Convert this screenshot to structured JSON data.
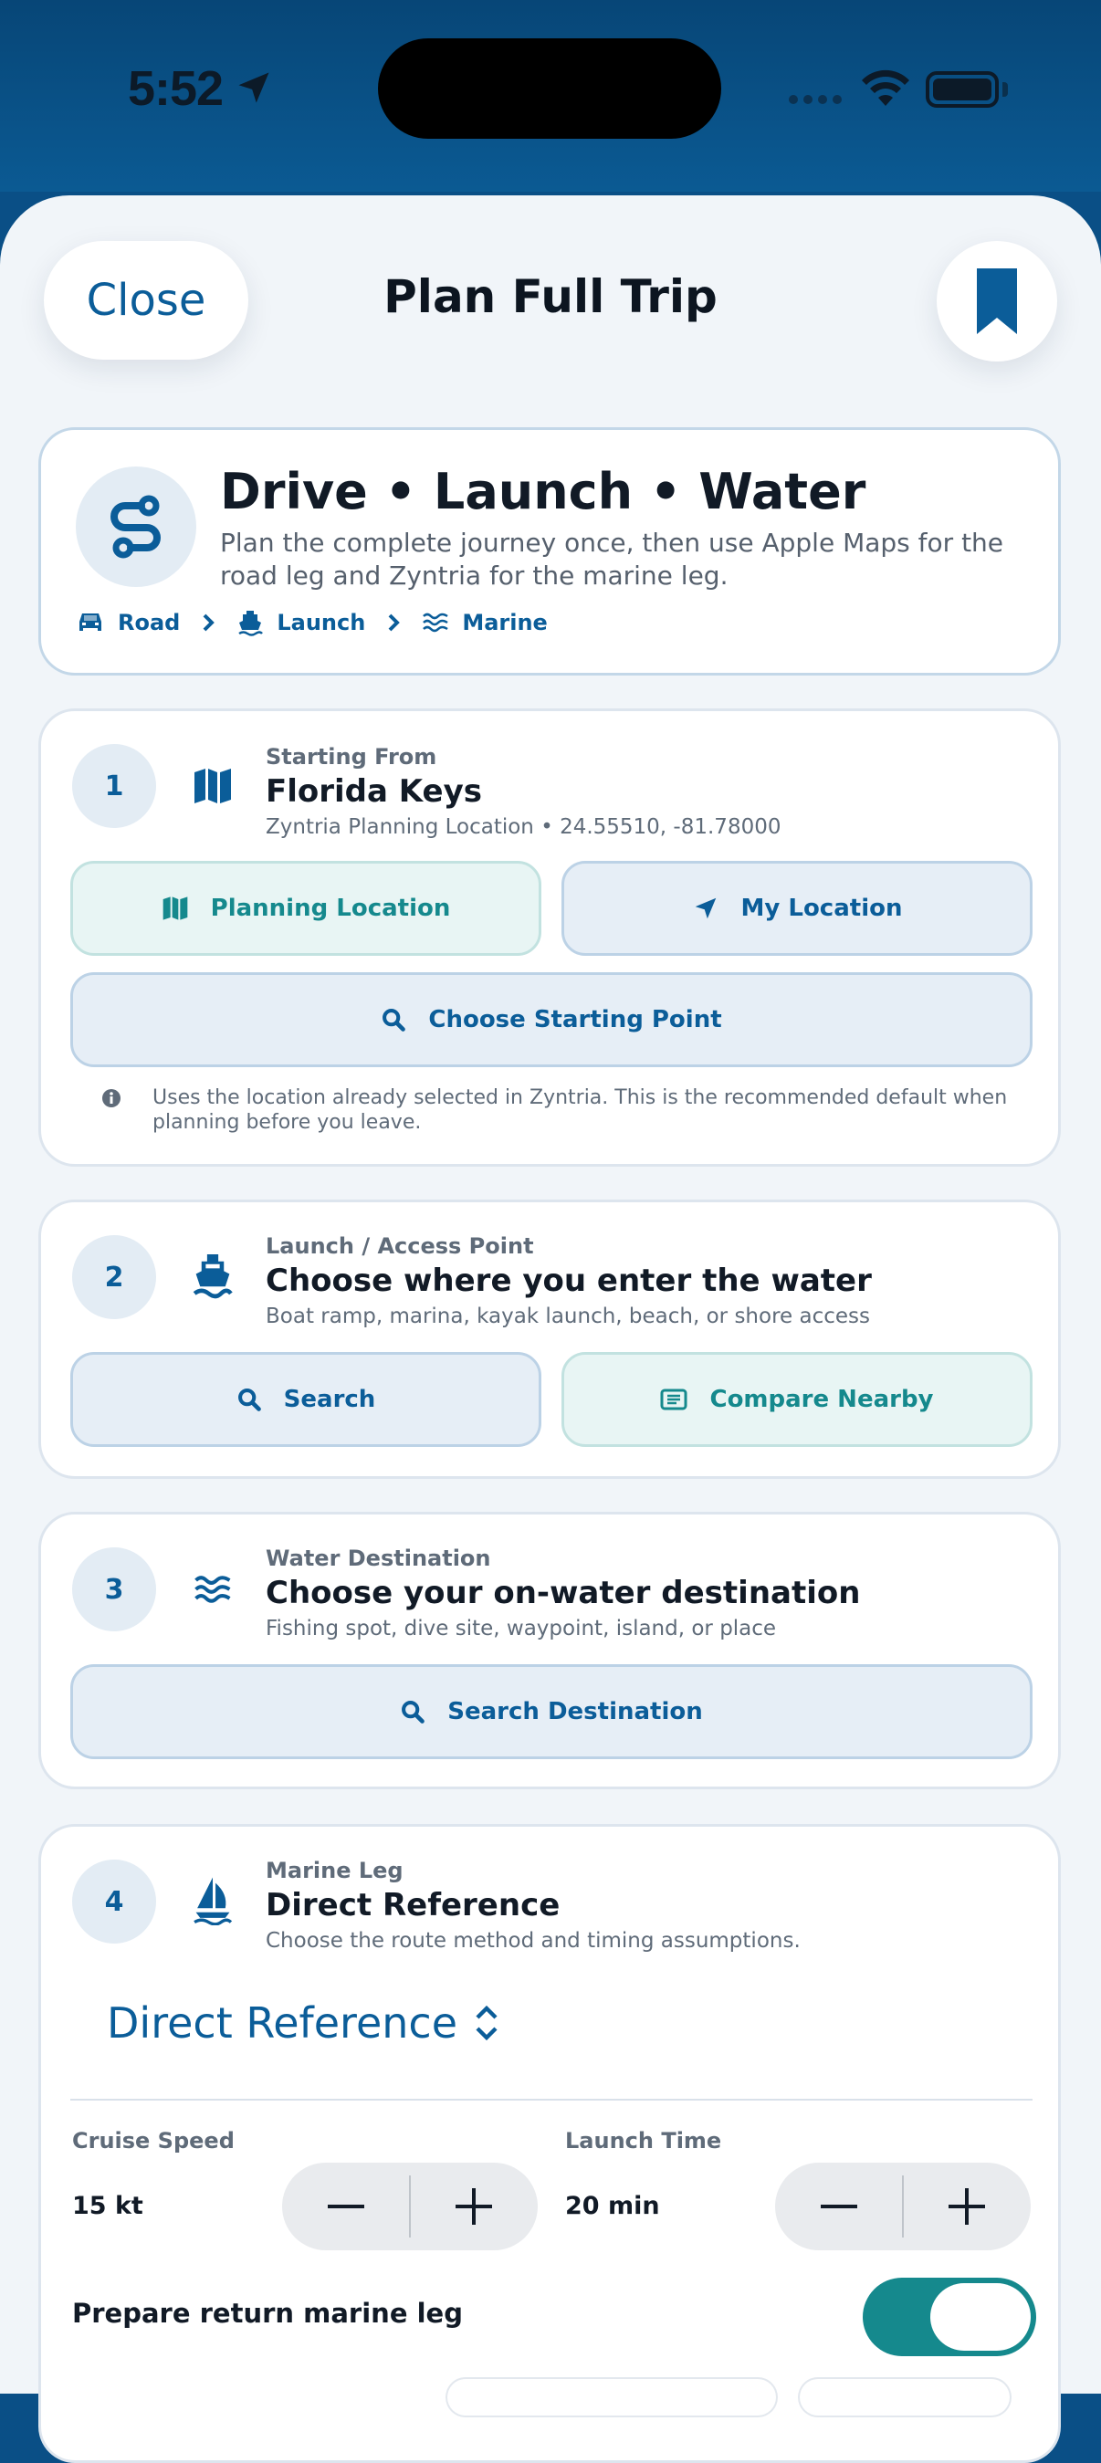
{
  "status": {
    "time": "5:52"
  },
  "header": {
    "close_label": "Close",
    "title": "Plan Full Trip",
    "bookmark_icon": "bookmark-icon"
  },
  "hero": {
    "title": "Drive • Launch • Water",
    "subtitle": "Plan the complete journey once, then use Apple Maps for the road leg and Zyntria for the marine leg.",
    "crumbs": [
      "Road",
      "Launch",
      "Marine"
    ]
  },
  "step1": {
    "number": "1",
    "kicker": "Starting From",
    "title": "Florida Keys",
    "subtitle": "Zyntria Planning Location • 24.55510, -81.78000",
    "planning_location_label": "Planning Location",
    "my_location_label": "My Location",
    "choose_start_label": "Choose Starting Point",
    "note": "Uses the location already selected in Zyntria. This is the recommended default when planning before you leave."
  },
  "step2": {
    "number": "2",
    "kicker": "Launch / Access Point",
    "title": "Choose where you enter the water",
    "subtitle": "Boat ramp, marina, kayak launch, beach, or shore access",
    "search_label": "Search",
    "compare_label": "Compare Nearby"
  },
  "step3": {
    "number": "3",
    "kicker": "Water Destination",
    "title": "Choose your on-water destination",
    "subtitle": "Fishing spot, dive site, waypoint, island, or place",
    "search_label": "Search Destination"
  },
  "step4": {
    "number": "4",
    "kicker": "Marine Leg",
    "title": "Direct Reference",
    "subtitle": "Choose the route method and timing assumptions.",
    "method_value": "Direct Reference",
    "cruise_speed_label": "Cruise Speed",
    "cruise_speed_value": "15 kt",
    "launch_time_label": "Launch Time",
    "launch_time_value": "20 min",
    "return_leg_label": "Prepare return marine leg",
    "return_leg_enabled": true
  },
  "colors": {
    "accent": "#0b5d99",
    "teal": "#15898d",
    "background": "#f1f5f9"
  }
}
